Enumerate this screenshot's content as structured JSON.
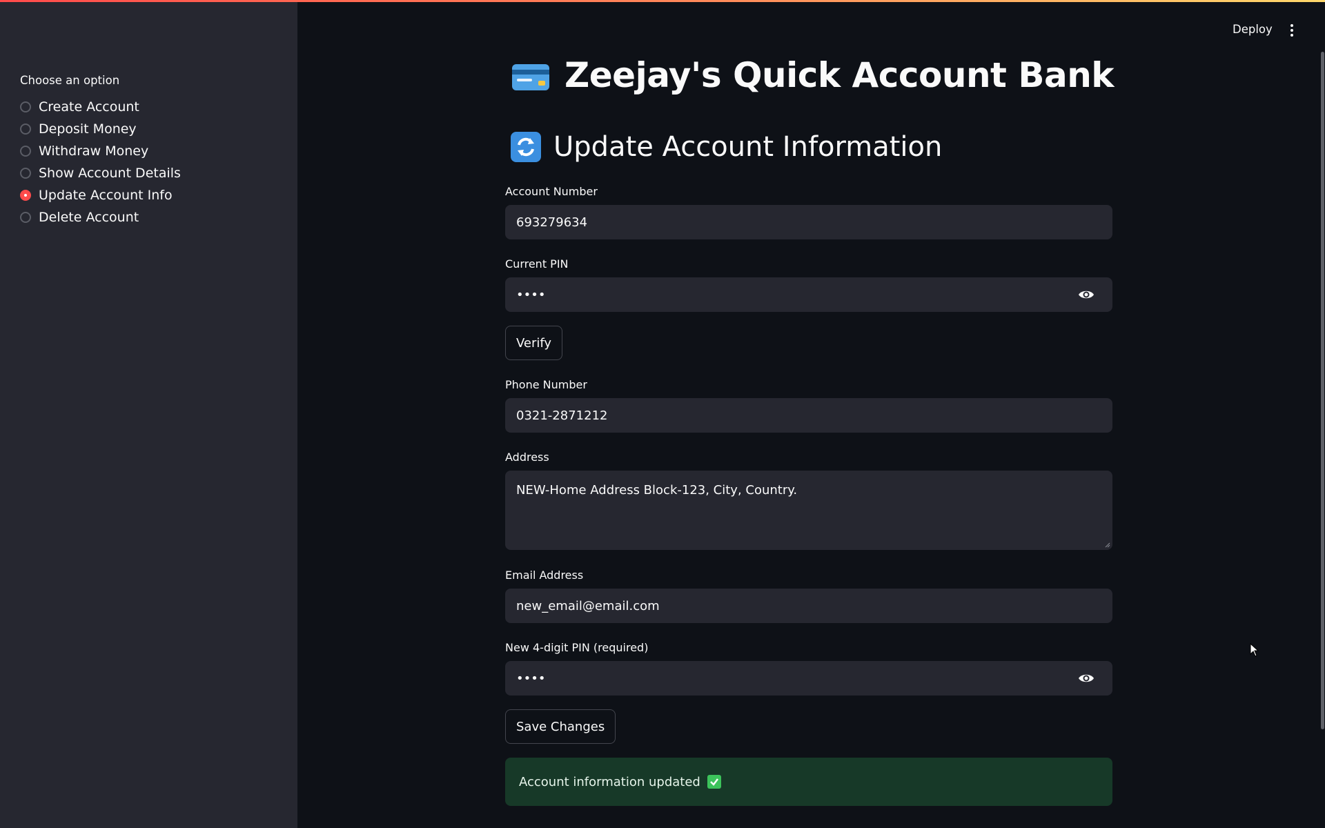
{
  "sidebar": {
    "label": "Choose an option",
    "options": [
      {
        "label": "Create Account",
        "selected": false
      },
      {
        "label": "Deposit Money",
        "selected": false
      },
      {
        "label": "Withdraw Money",
        "selected": false
      },
      {
        "label": "Show Account Details",
        "selected": false
      },
      {
        "label": "Update Account Info",
        "selected": true
      },
      {
        "label": "Delete Account",
        "selected": false
      }
    ]
  },
  "header": {
    "deploy_label": "Deploy",
    "menu_icon": "kebab-menu-icon"
  },
  "main": {
    "title": "Zeejay's Quick Account Bank",
    "title_icon": "credit-card-icon",
    "subtitle": "Update Account Information",
    "subtitle_icon": "refresh-icon",
    "fields": {
      "account_number": {
        "label": "Account Number",
        "value": "693279634"
      },
      "current_pin": {
        "label": "Current PIN",
        "value": "••••"
      },
      "phone": {
        "label": "Phone Number",
        "value": "0321-2871212"
      },
      "address": {
        "label": "Address",
        "value": "NEW-Home Address Block-123, City, Country."
      },
      "email": {
        "label": "Email Address",
        "value": "new_email@email.com"
      },
      "new_pin": {
        "label": "New 4-digit PIN (required)",
        "value": "••••"
      }
    },
    "verify_label": "Verify",
    "save_label": "Save Changes",
    "success_message": "Account information updated",
    "success_icon": "check-mark-icon"
  },
  "colors": {
    "accent": "#ff4b4b",
    "background": "#0e1117",
    "sidebar": "#262730",
    "input_bg": "#262730",
    "success_bg": "#173928"
  }
}
